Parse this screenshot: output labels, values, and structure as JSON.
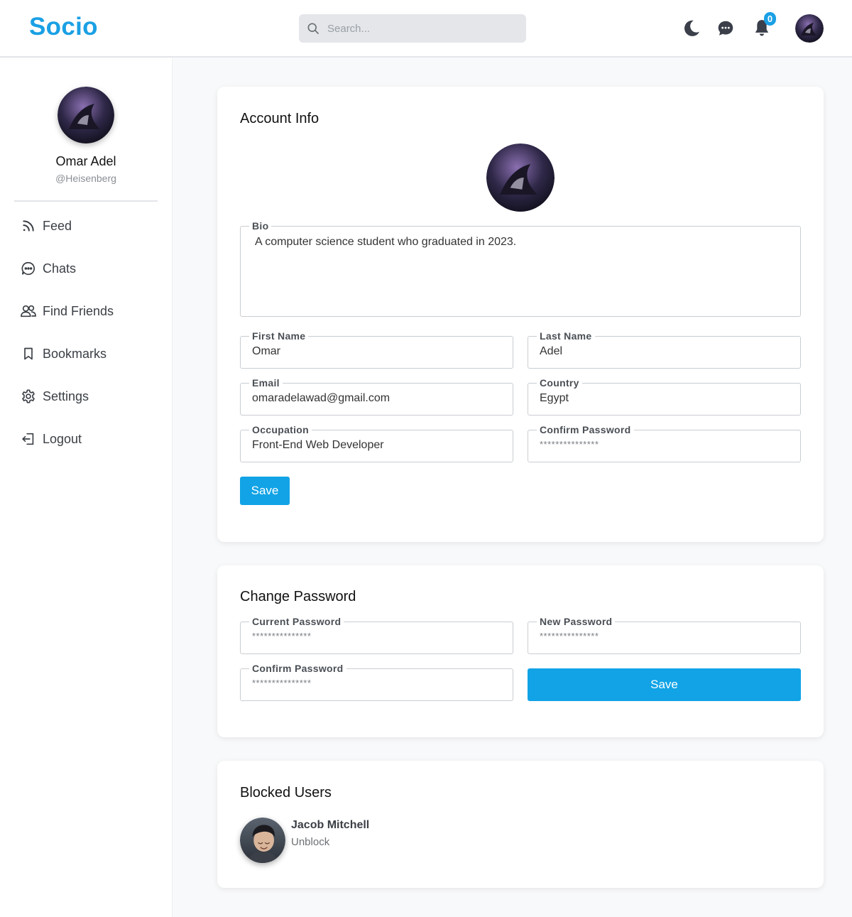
{
  "header": {
    "logo": "Socio",
    "search_placeholder": "Search...",
    "notification_count": "0",
    "icons": [
      "moon-icon",
      "chat-icon",
      "bell-icon"
    ]
  },
  "sidebar": {
    "name": "Omar Adel",
    "handle": "@Heisenberg",
    "items": [
      {
        "label": "Feed",
        "icon": "rss-icon"
      },
      {
        "label": "Chats",
        "icon": "chat-bubble-icon"
      },
      {
        "label": "Find Friends",
        "icon": "users-icon"
      },
      {
        "label": "Bookmarks",
        "icon": "bookmark-icon"
      },
      {
        "label": "Settings",
        "icon": "gear-icon"
      },
      {
        "label": "Logout",
        "icon": "logout-icon"
      }
    ]
  },
  "account": {
    "title": "Account Info",
    "bio_label": "Bio",
    "bio": "A computer science student who graduated in 2023.",
    "first_name_label": "First Name",
    "first_name": "Omar",
    "last_name_label": "Last Name",
    "last_name": "Adel",
    "email_label": "Email",
    "email": "omaradelawad@gmail.com",
    "country_label": "Country",
    "country": "Egypt",
    "occupation_label": "Occupation",
    "occupation": "Front-End Web Developer",
    "confirm_password_label": "Confirm Password",
    "confirm_password_mask": "***************",
    "save_label": "Save"
  },
  "password": {
    "title": "Change Password",
    "current_label": "Current Password",
    "current_mask": "***************",
    "new_label": "New Password",
    "new_mask": "***************",
    "confirm_label": "Confirm Password",
    "confirm_mask": "***************",
    "save_label": "Save"
  },
  "blocked": {
    "title": "Blocked Users",
    "users": [
      {
        "name": "Jacob Mitchell",
        "action": "Unblock"
      }
    ]
  },
  "colors": {
    "accent": "#1aa0e4",
    "button": "#11a3e6"
  }
}
